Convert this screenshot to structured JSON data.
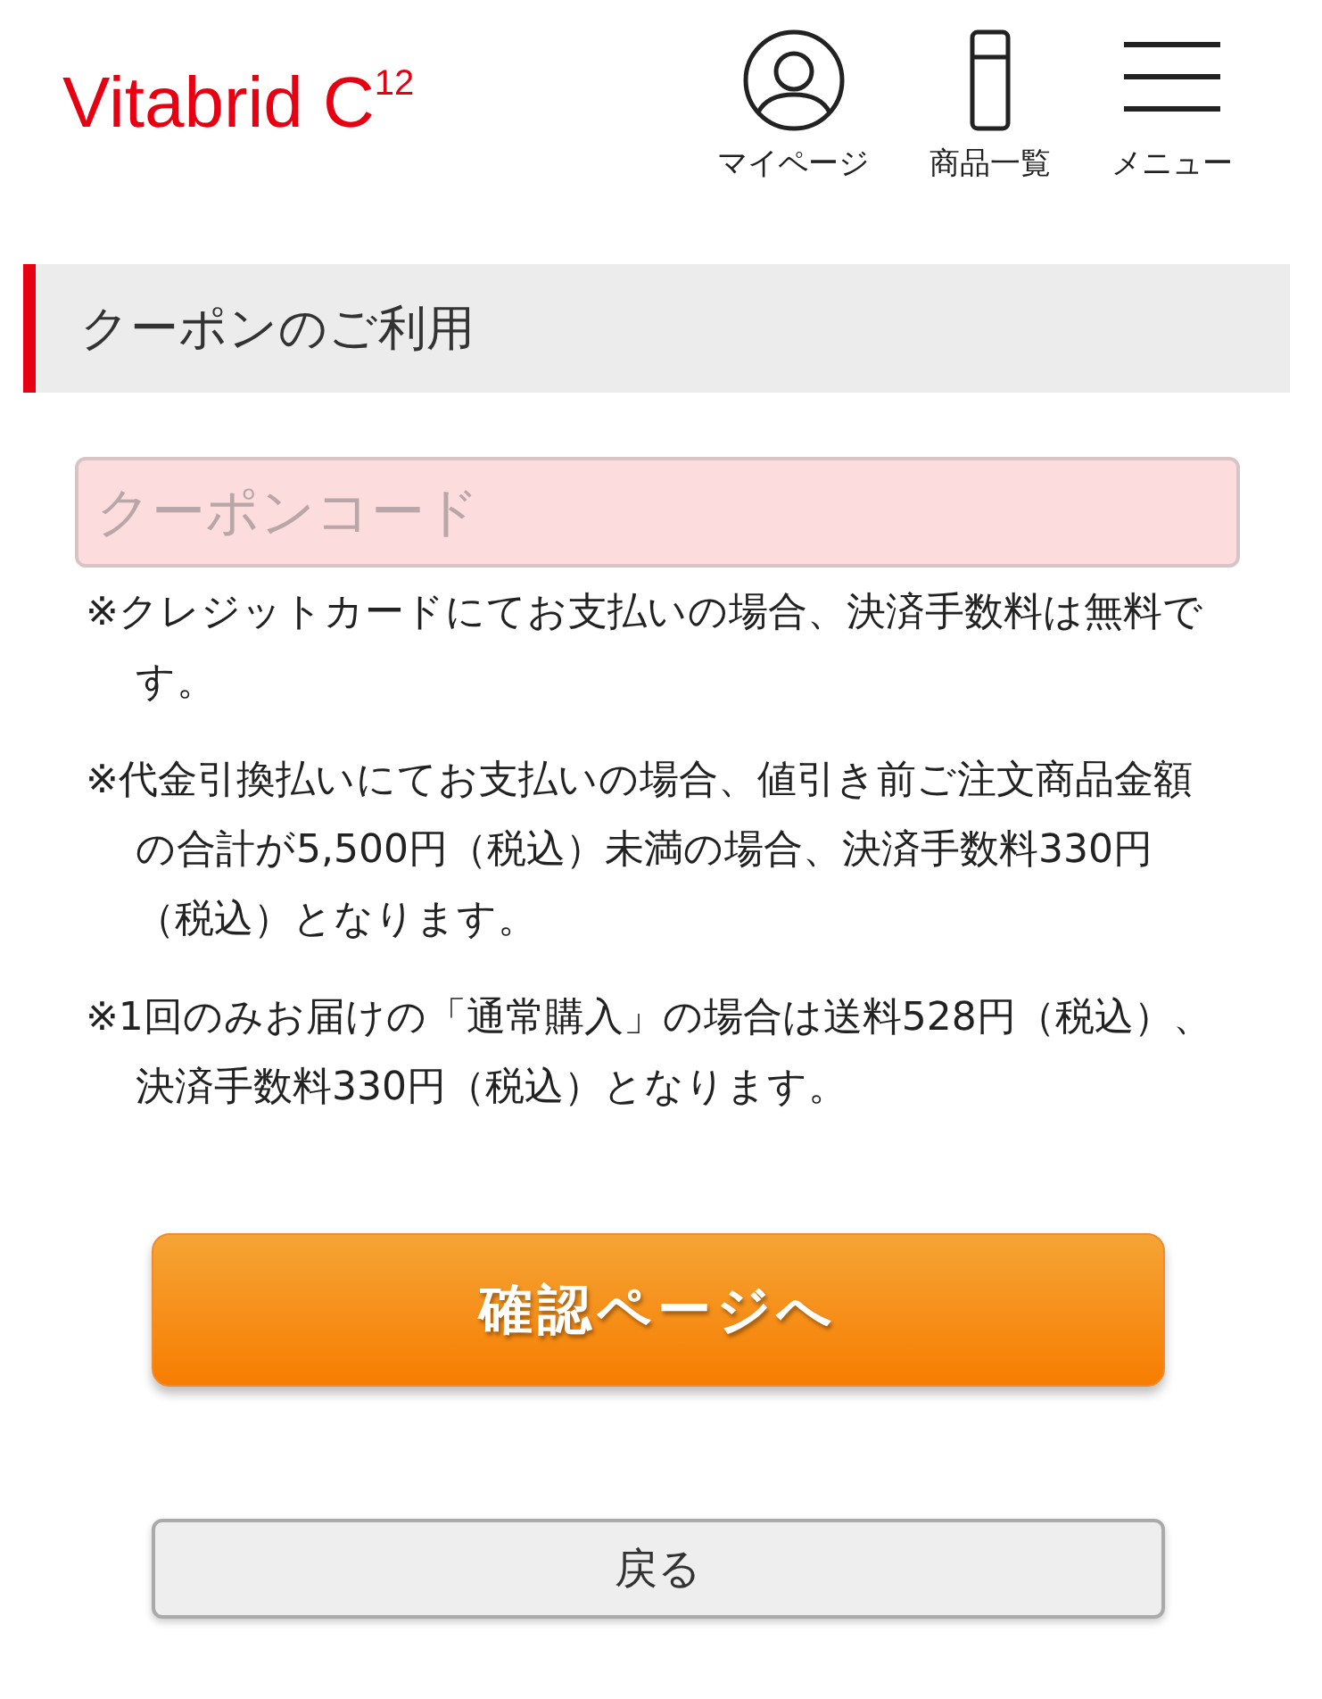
{
  "header": {
    "logo": "Vitabrid C$^{12}$",
    "nav": [
      {
        "kind": "account",
        "label": "マイページ"
      },
      {
        "kind": "products",
        "label": "商品一覧"
      },
      {
        "kind": "menu",
        "label": "メニュー"
      }
    ]
  },
  "section_title": "クーポンのご利用",
  "coupon_field": {
    "placeholder": "クーポンコード"
  },
  "notes": [
    "※クレジットカードにてお支払いの場合、決済手数料は無料です。",
    "※代金引換払いにてお支払いの場合、値引き前ご注文商品金額の合計が5,500円（税込）未満の場合、決済手数料330円（税込）となります。",
    "※1回のみお届けの「通常購入」の場合は送料528円（税込）、決済手数料330円（税込）となります。"
  ],
  "confirm_button": "確認ページへ",
  "back_button": "戻る"
}
